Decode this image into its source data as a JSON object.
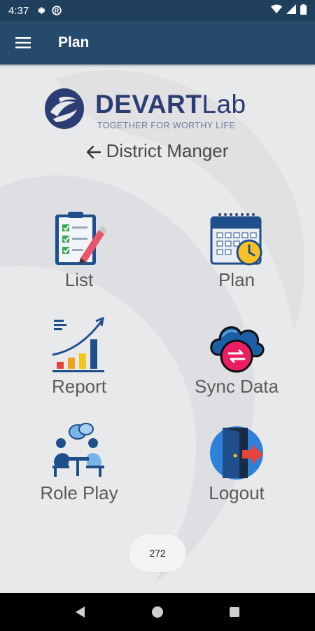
{
  "status_bar": {
    "time": "4:37"
  },
  "app_bar": {
    "title": "Plan"
  },
  "logo": {
    "word_bold": "DEVART",
    "word_light": "Lab",
    "tagline": "TOGETHER FOR WORTHY LIFE"
  },
  "role": {
    "label": "District Manger"
  },
  "tiles": [
    {
      "label": "List",
      "icon": "checklist-icon"
    },
    {
      "label": "Plan",
      "icon": "calendar-icon"
    },
    {
      "label": "Report",
      "icon": "growth-chart-icon"
    },
    {
      "label": "Sync Data",
      "icon": "cloud-sync-icon"
    },
    {
      "label": "Role Play",
      "icon": "meeting-icon"
    },
    {
      "label": "Logout",
      "icon": "logout-door-icon"
    }
  ],
  "counter": {
    "value": "272"
  },
  "colors": {
    "status_bar": "#1f3f5c",
    "app_bar": "#254a6b",
    "background": "#e8e9eb",
    "logo_navy": "#2c3d73"
  }
}
